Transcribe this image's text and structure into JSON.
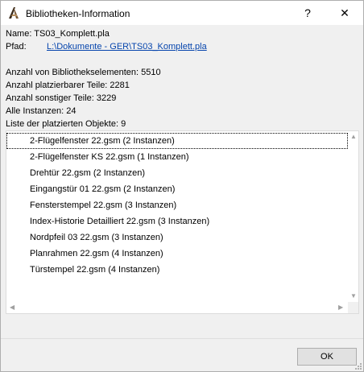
{
  "window": {
    "title": "Bibliotheken-Information",
    "help_glyph": "?",
    "close_glyph": "✕"
  },
  "info": {
    "name_label": "Name:",
    "name_value": "TS03_Komplett.pla",
    "path_label": "Pfad:",
    "path_value": "L:\\Dokumente - GER\\TS03_Komplett.pla",
    "library_elements": "Anzahl von Bibliothekselementen: 5510",
    "placeable_parts": "Anzahl platzierbarer Teile: 2281",
    "other_parts": "Anzahl sonstiger Teile: 3229",
    "all_instances": "Alle Instanzen: 24",
    "placed_list_label": "Liste der platzierten Objekte: 9"
  },
  "placed_objects": [
    "2-Flügelfenster 22.gsm (2 Instanzen)",
    "2-Flügelfenster KS 22.gsm (1 Instanzen)",
    "Drehtür 22.gsm (2 Instanzen)",
    "Eingangstür 01 22.gsm (2 Instanzen)",
    "Fensterstempel 22.gsm (3 Instanzen)",
    "Index-Historie Detailliert 22.gsm (3 Instanzen)",
    "Nordpfeil 03 22.gsm (3 Instanzen)",
    "Planrahmen 22.gsm (4 Instanzen)",
    "Türstempel 22.gsm (4 Instanzen)"
  ],
  "buttons": {
    "ok": "OK"
  },
  "colors": {
    "link": "#0645ad",
    "dialog_bg": "#f0f0f0",
    "button_bg": "#e1e1e1"
  }
}
